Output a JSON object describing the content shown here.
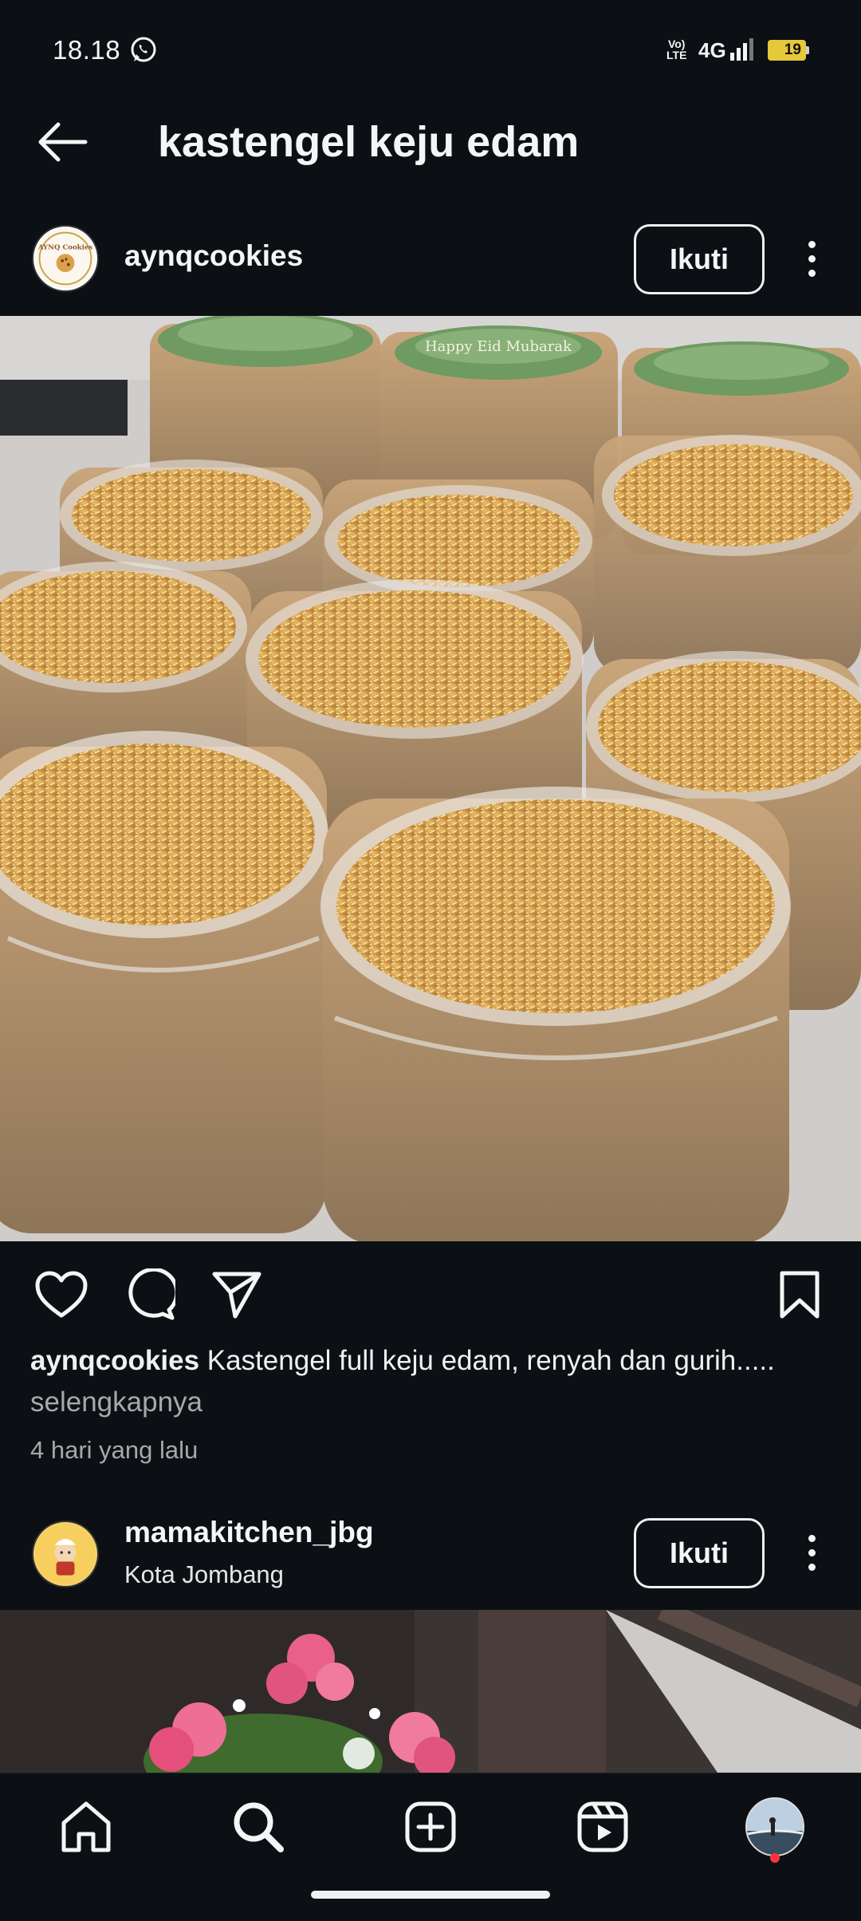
{
  "status_bar": {
    "time": "18.18",
    "volte_line1": "Vo)",
    "volte_line2": "LTE",
    "network": "4G",
    "battery": "19"
  },
  "header": {
    "title": "kastengel keju edam"
  },
  "post": {
    "username": "aynqcookies",
    "avatar_text": "AYNQ Cookies",
    "follow_label": "Ikuti",
    "image_jar_label": "Happy Eid Mubarak",
    "caption_username": "aynqcookies",
    "caption_text": " Kastengel full keju edam, renyah dan gurih.....",
    "more_label": "selengkapnya",
    "time_ago": "4 hari yang lalu"
  },
  "next_post": {
    "username": "mamakitchen_jbg",
    "location": "Kota Jombang",
    "follow_label": "Ikuti"
  },
  "icons": {
    "back": "arrow-left-icon",
    "like": "heart-icon",
    "comment": "comment-icon",
    "share": "paper-plane-icon",
    "save": "bookmark-icon",
    "more": "more-vertical-icon",
    "nav": [
      "home-icon",
      "search-icon",
      "create-icon",
      "reels-icon",
      "profile-avatar"
    ]
  },
  "colors": {
    "background": "#0c1014",
    "text": "#f5f5f5",
    "secondary_text": "#a8a8a8",
    "battery": "#e6c93a",
    "notification": "#ff3040"
  }
}
